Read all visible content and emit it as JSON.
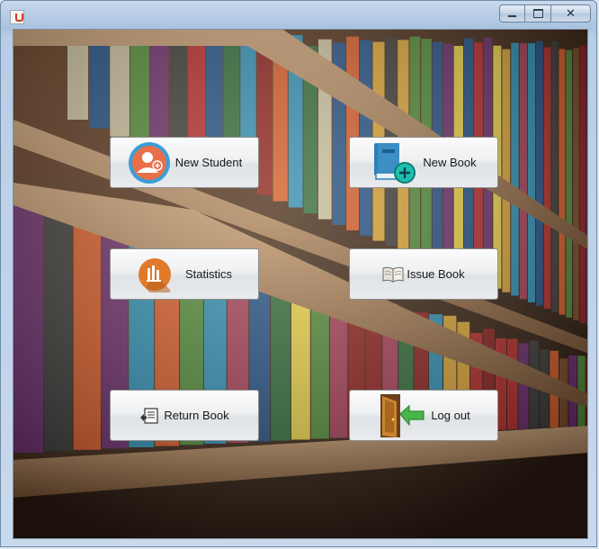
{
  "window": {
    "controls": {
      "minimize": "minimize-icon",
      "maximize": "maximize-icon",
      "close_glyph": "✕"
    }
  },
  "menu": {
    "new_student": {
      "label": "New Student",
      "icon": "student-add-icon"
    },
    "new_book": {
      "label": "New Book",
      "icon": "book-add-icon"
    },
    "statistics": {
      "label": "Statistics",
      "icon": "statistics-icon"
    },
    "issue_book": {
      "label": "Issue Book",
      "icon": "open-book-icon"
    },
    "return_book": {
      "label": "Return Book",
      "icon": "return-book-icon"
    },
    "log_out": {
      "label": "Log out",
      "icon": "logout-door-icon"
    }
  },
  "colors": {
    "student_icon": "#e96f4a",
    "student_ring": "#3a9fd6",
    "book_icon": "#3c8fc4",
    "book_plus": "#1fbfb0",
    "stats_icon": "#e07a2a",
    "logout_arrow": "#49b649"
  }
}
